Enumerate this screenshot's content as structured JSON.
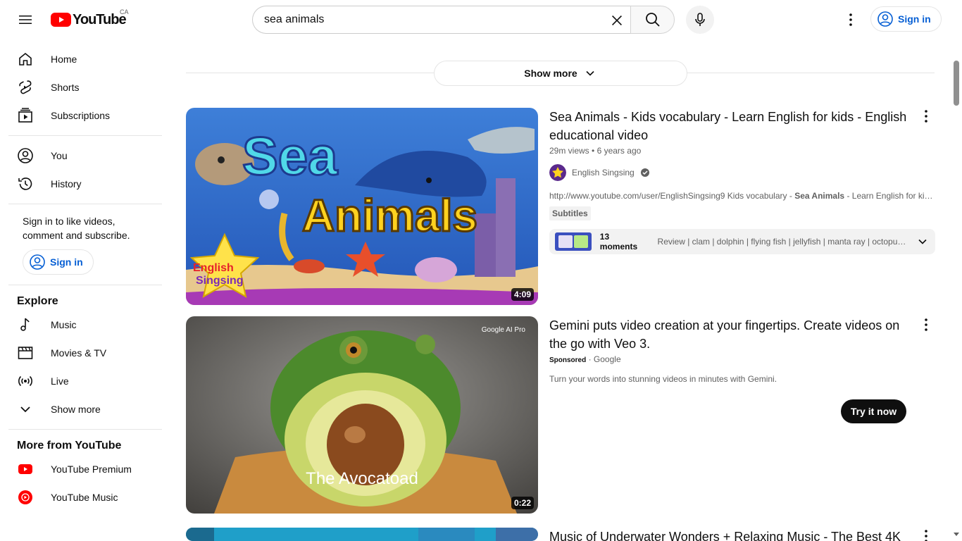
{
  "header": {
    "logo_text": "YouTube",
    "country_code": "CA",
    "search_value": "sea animals",
    "search_placeholder": "Search",
    "signin_label": "Sign in"
  },
  "sidebar": {
    "main_items": [
      {
        "label": "Home",
        "icon": "home-icon"
      },
      {
        "label": "Shorts",
        "icon": "shorts-icon"
      },
      {
        "label": "Subscriptions",
        "icon": "subscriptions-icon"
      }
    ],
    "you_items": [
      {
        "label": "You",
        "icon": "you-icon"
      },
      {
        "label": "History",
        "icon": "history-icon"
      }
    ],
    "signin_prompt": "Sign in to like videos, comment and subscribe.",
    "signin_label": "Sign in",
    "explore_title": "Explore",
    "explore_items": [
      {
        "label": "Music",
        "icon": "music-icon"
      },
      {
        "label": "Movies & TV",
        "icon": "movies-icon"
      },
      {
        "label": "Live",
        "icon": "live-icon"
      },
      {
        "label": "Show more",
        "icon": "chevron-down-icon"
      }
    ],
    "more_title": "More from YouTube",
    "more_items": [
      {
        "label": "YouTube Premium",
        "icon": "youtube-premium-icon"
      },
      {
        "label": "YouTube Music",
        "icon": "youtube-music-icon"
      }
    ]
  },
  "main": {
    "show_more_label": "Show more",
    "results": [
      {
        "title": "Sea Animals - Kids vocabulary - Learn English for kids - English educational video",
        "views": "29m views",
        "age": "6 years ago",
        "channel": "English Singsing",
        "description_prefix": "http://www.youtube.com/user/EnglishSingsing9 Kids vocabulary - ",
        "description_bold": "Sea Animals",
        "description_suffix": " - Learn English for kid...",
        "badge": "Subtitles",
        "duration": "4:09",
        "thumb_title_line1": "Sea",
        "thumb_title_line2": "Animals",
        "thumb_logo_line1": "English",
        "thumb_logo_line2": "Singsing",
        "moments_count": "13 moments",
        "moments_list": "Review | clam | dolphin | flying fish | jellyfish | manta ray | octopus ..."
      },
      {
        "title": "Gemini puts video creation at your fingertips. Create videos on the go with Veo 3.",
        "sponsored": "Sponsored",
        "advertiser": "Google",
        "description": "Turn your words into stunning videos in minutes with Gemini.",
        "cta": "Try it now",
        "duration": "0:22",
        "thumb_caption": "The Avocatoad",
        "thumb_brand": "Google AI Pro"
      },
      {
        "title": "Music of Underwater Wonders + Relaxing Music - The Best 4K"
      }
    ]
  },
  "colors": {
    "brand_red": "#ff0000",
    "link_blue": "#065fd4",
    "text_primary": "#0f0f0f",
    "text_secondary": "#606060"
  }
}
